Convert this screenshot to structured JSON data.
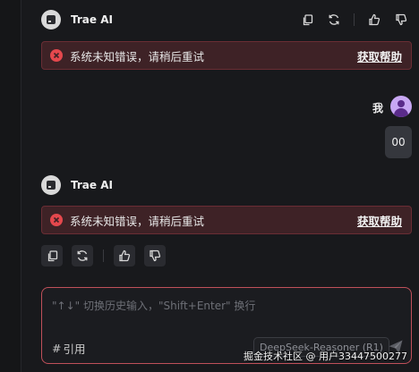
{
  "messages": [
    {
      "role": "assistant",
      "name": "Trae AI",
      "error": {
        "text": "系统未知错误，请稍后重试",
        "help_label": "获取帮助"
      }
    },
    {
      "role": "user",
      "name": "我",
      "text": "00"
    },
    {
      "role": "assistant",
      "name": "Trae AI",
      "error": {
        "text": "系统未知错误，请稍后重试",
        "help_label": "获取帮助"
      }
    }
  ],
  "icons": {
    "copy": "copy-icon",
    "regenerate": "refresh-icon",
    "like": "thumbs-up-icon",
    "dislike": "thumbs-down-icon",
    "error": "error-circle-icon",
    "send": "send-icon"
  },
  "composer": {
    "placeholder": "\"↑↓\" 切换历史输入，\"Shift+Enter\" 换行",
    "reference_label": "引用",
    "reference_prefix": "#",
    "model": "DeepSeek-Reasoner (R1)"
  },
  "watermark": "掘金技术社区 @ 用户33447500277",
  "colors": {
    "background": "#18191c",
    "error_bg": "#3e2226",
    "error_border": "#6a2d34",
    "error_icon": "#e5484d",
    "composer_border": "#c0505a",
    "user_avatar": "#c8a7f3"
  }
}
